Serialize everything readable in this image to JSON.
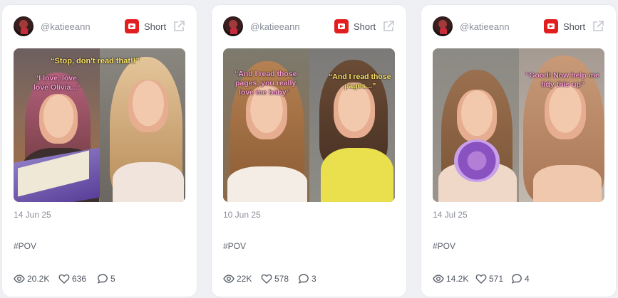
{
  "posts": [
    {
      "handle": "@katieeann",
      "type": "Short",
      "date": "14 Jun 25",
      "tag": "#POV",
      "views": "20.2K",
      "likes": "636",
      "comments": "5",
      "captions": [
        "“Stop, don't read that!!”",
        "“I love, love,",
        "love Olivia...”"
      ]
    },
    {
      "handle": "@katieeann",
      "type": "Short",
      "date": "10 Jun 25",
      "tag": "#POV",
      "views": "22K",
      "likes": "578",
      "comments": "3",
      "captions": [
        "“And I read those",
        "pages, you really",
        "love me baby”",
        "“And I read those",
        "pages...”"
      ]
    },
    {
      "handle": "@katieeann",
      "type": "Short",
      "date": "14 Jul 25",
      "tag": "#POV",
      "views": "14.2K",
      "likes": "571",
      "comments": "4",
      "captions": [
        "“Good! Now help me",
        "tidy this up”"
      ]
    }
  ],
  "icons": {
    "platform": "youtube-icon",
    "external": "external-link-icon",
    "views": "eye-icon",
    "likes": "heart-icon",
    "comments": "comment-icon"
  },
  "colors": {
    "background": "#eef0f4",
    "card": "#ffffff",
    "youtube_red": "#e21e1e",
    "muted_text": "#8a8f99",
    "caption_pink": "#ff9fd4",
    "caption_yellow": "#ffe56b"
  }
}
